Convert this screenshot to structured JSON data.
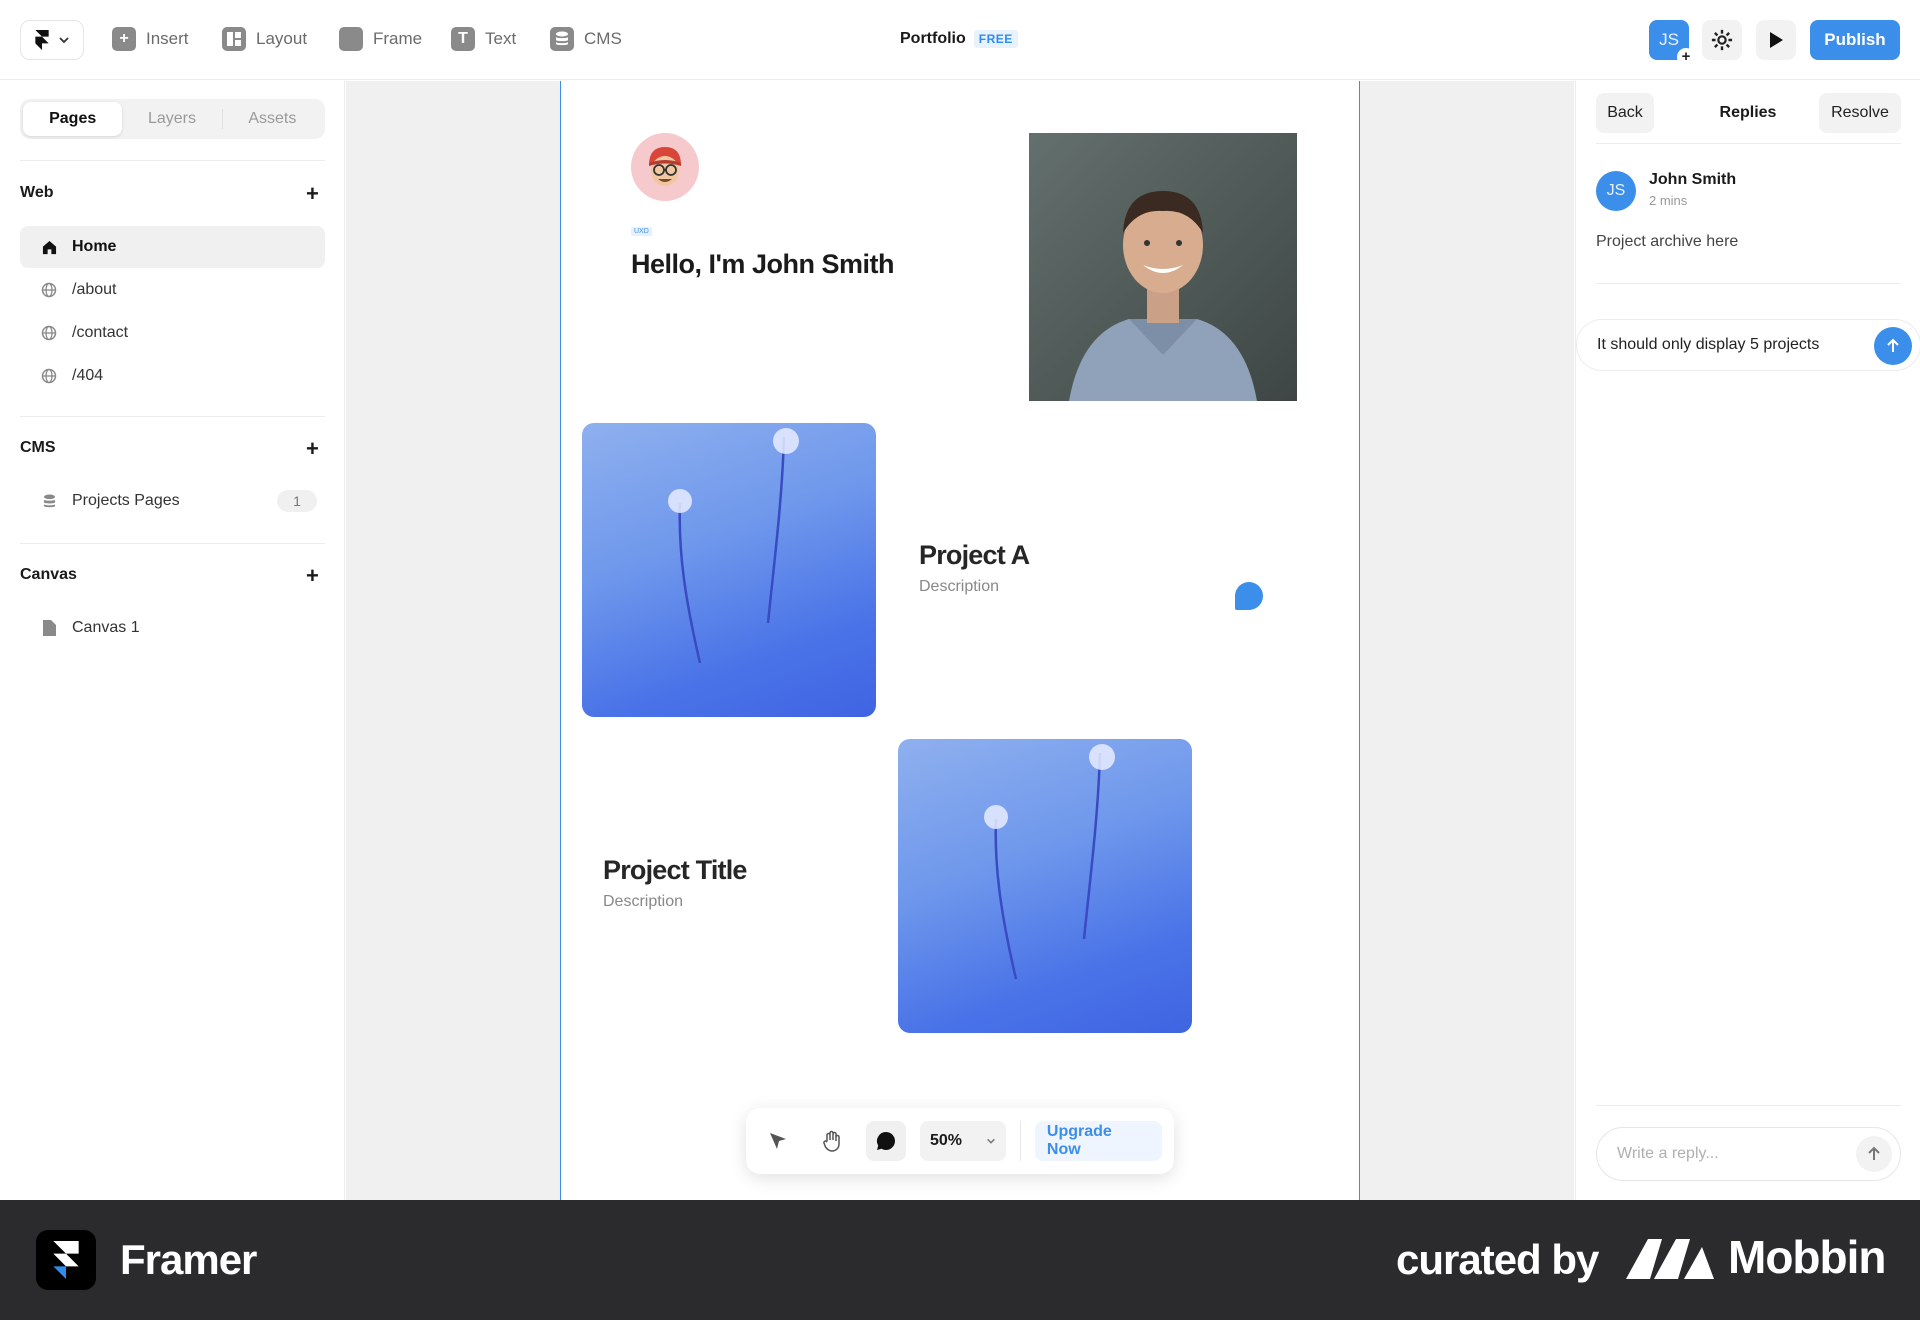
{
  "toolbar": {
    "insert": "Insert",
    "layout": "Layout",
    "frame": "Frame",
    "text": "Text",
    "cms": "CMS",
    "project_name": "Portfolio",
    "plan_badge": "FREE",
    "user_initials": "JS",
    "publish": "Publish"
  },
  "left_panel": {
    "tabs": [
      "Pages",
      "Layers",
      "Assets"
    ],
    "web": {
      "title": "Web",
      "items": [
        "Home",
        "/about",
        "/contact",
        "/404"
      ]
    },
    "cms": {
      "title": "CMS",
      "items": [
        {
          "label": "Projects Pages",
          "count": "1"
        }
      ]
    },
    "canvas": {
      "title": "Canvas",
      "items": [
        "Canvas 1"
      ]
    }
  },
  "canvas": {
    "tag": "UXD",
    "headline": "Hello, I'm John Smith",
    "project_a_title": "Project A",
    "project_a_desc": "Description",
    "project_b_title": "Project Title",
    "project_b_desc": "Description"
  },
  "floating_toolbar": {
    "zoom": "50%",
    "upgrade": "Upgrade Now"
  },
  "comments": {
    "back": "Back",
    "title": "Replies",
    "resolve": "Resolve",
    "author_initials": "JS",
    "author": "John Smith",
    "time": "2 mins",
    "text": "Project archive here",
    "draft": "It should only display 5 projects",
    "reply_placeholder": "Write a reply..."
  },
  "footer": {
    "app_name": "Framer",
    "curated_by": "curated by",
    "brand": "Mobbin"
  },
  "colors": {
    "accent": "#3b8eea",
    "footer_bg": "#2b2b2d"
  }
}
